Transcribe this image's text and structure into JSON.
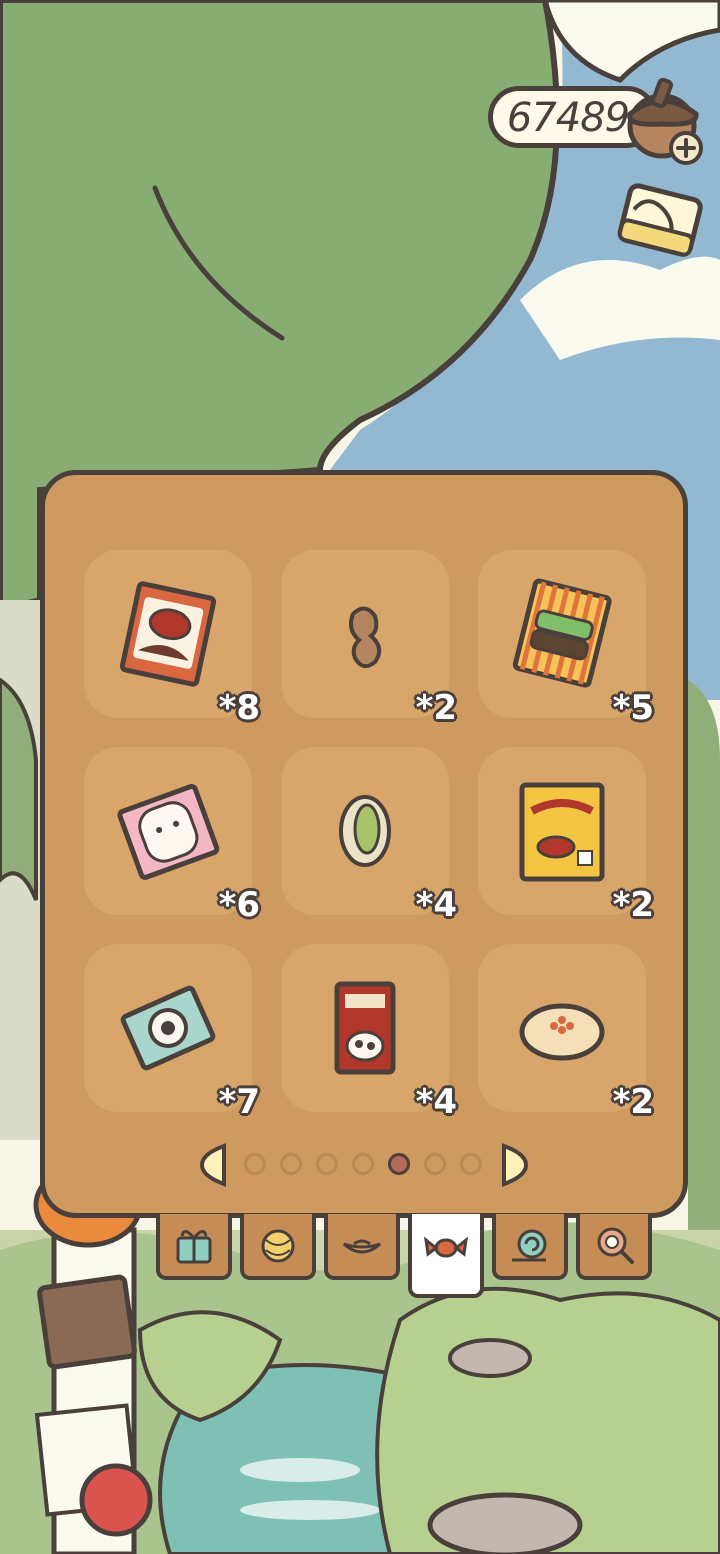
{
  "currency": {
    "amount": "67489",
    "icon": "acorn-icon"
  },
  "inventory": {
    "items": [
      {
        "icon": "red-snack-bag-icon",
        "count": "*8"
      },
      {
        "icon": "peanut-icon",
        "count": "*2"
      },
      {
        "icon": "striped-snack-bag-icon",
        "count": "*5"
      },
      {
        "icon": "pink-candy-bag-icon",
        "count": "*6"
      },
      {
        "icon": "pistachio-icon",
        "count": "*4"
      },
      {
        "icon": "yellow-chips-bag-icon",
        "count": "*2"
      },
      {
        "icon": "mint-candy-icon",
        "count": "*7"
      },
      {
        "icon": "milk-carton-icon",
        "count": "*4"
      },
      {
        "icon": "bun-icon",
        "count": "*2"
      }
    ]
  },
  "pagination": {
    "pages": 7,
    "current": 5
  },
  "tabs": [
    "gift-icon",
    "yarn-icon",
    "plate-icon",
    "candy-icon",
    "snail-icon",
    "magnifier-icon"
  ],
  "active_tab": 3,
  "colors": {
    "panel": "#cf9a5f",
    "slot": "#d8a56a",
    "outline": "#4a403b",
    "sky": "#93b9d2",
    "tree": "#88ad72"
  }
}
